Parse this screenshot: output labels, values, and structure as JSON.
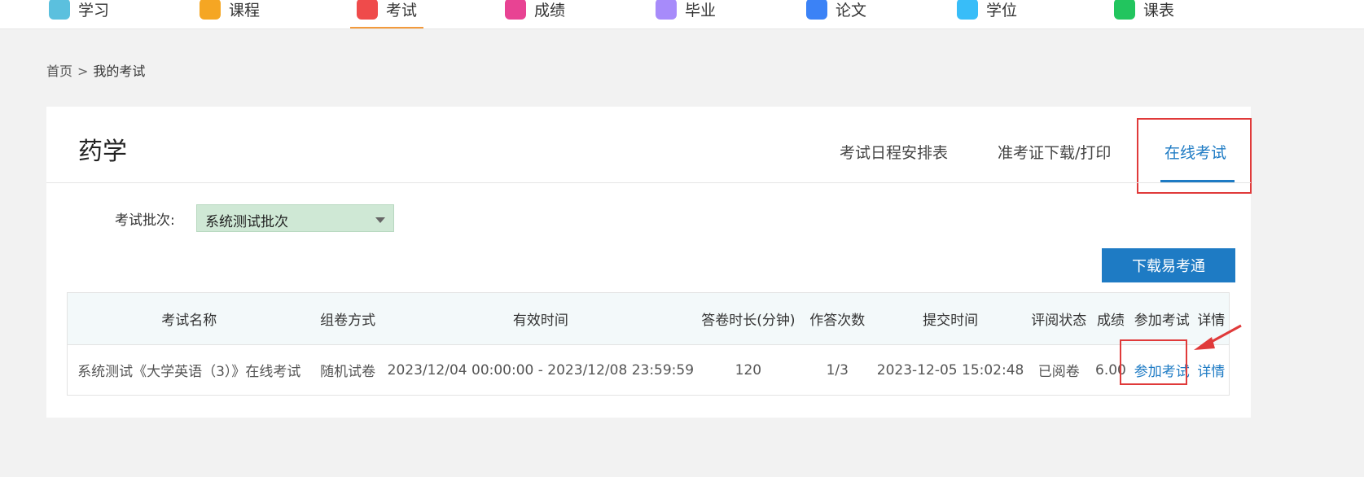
{
  "nav": {
    "items": [
      {
        "label": "学习",
        "color": "#5bc0de"
      },
      {
        "label": "课程",
        "color": "#f5a623"
      },
      {
        "label": "考试",
        "color": "#ef4b4b",
        "active": true
      },
      {
        "label": "成绩",
        "color": "#e84393"
      },
      {
        "label": "毕业",
        "color": "#a78bfa"
      },
      {
        "label": "论文",
        "color": "#3b82f6"
      },
      {
        "label": "学位",
        "color": "#38bdf8"
      },
      {
        "label": "课表",
        "color": "#22c55e"
      }
    ]
  },
  "breadcrumb": {
    "home": "首页",
    "separator": ">",
    "current": "我的考试"
  },
  "card": {
    "title": "药学",
    "tabs": [
      "考试日程安排表",
      "准考证下载/打印",
      "在线考试"
    ],
    "active_tab": "在线考试"
  },
  "filter": {
    "label": "考试批次:",
    "selected": "系统测试批次"
  },
  "download_button": "下载易考通",
  "table": {
    "headers": [
      "考试名称",
      "组卷方式",
      "有效时间",
      "答卷时长(分钟)",
      "作答次数",
      "提交时间",
      "评阅状态",
      "成绩",
      "参加考试",
      "详情"
    ],
    "rows": [
      {
        "name": "系统测试《大学英语（3）》在线考试",
        "method": "随机试卷",
        "valid_time": "2023/12/04 00:00:00 - 2023/12/08 23:59:59",
        "duration": "120",
        "attempts": "1/3",
        "submit_time": "2023-12-05 15:02:48",
        "review_status": "已阅卷",
        "score": "6.00",
        "join": "参加考试",
        "detail": "详情"
      }
    ]
  },
  "colors": {
    "accent": "#1e7bc4",
    "highlight": "#e03a3a",
    "select_bg": "#cfe8d5",
    "nav_active": "#f39a3c"
  }
}
